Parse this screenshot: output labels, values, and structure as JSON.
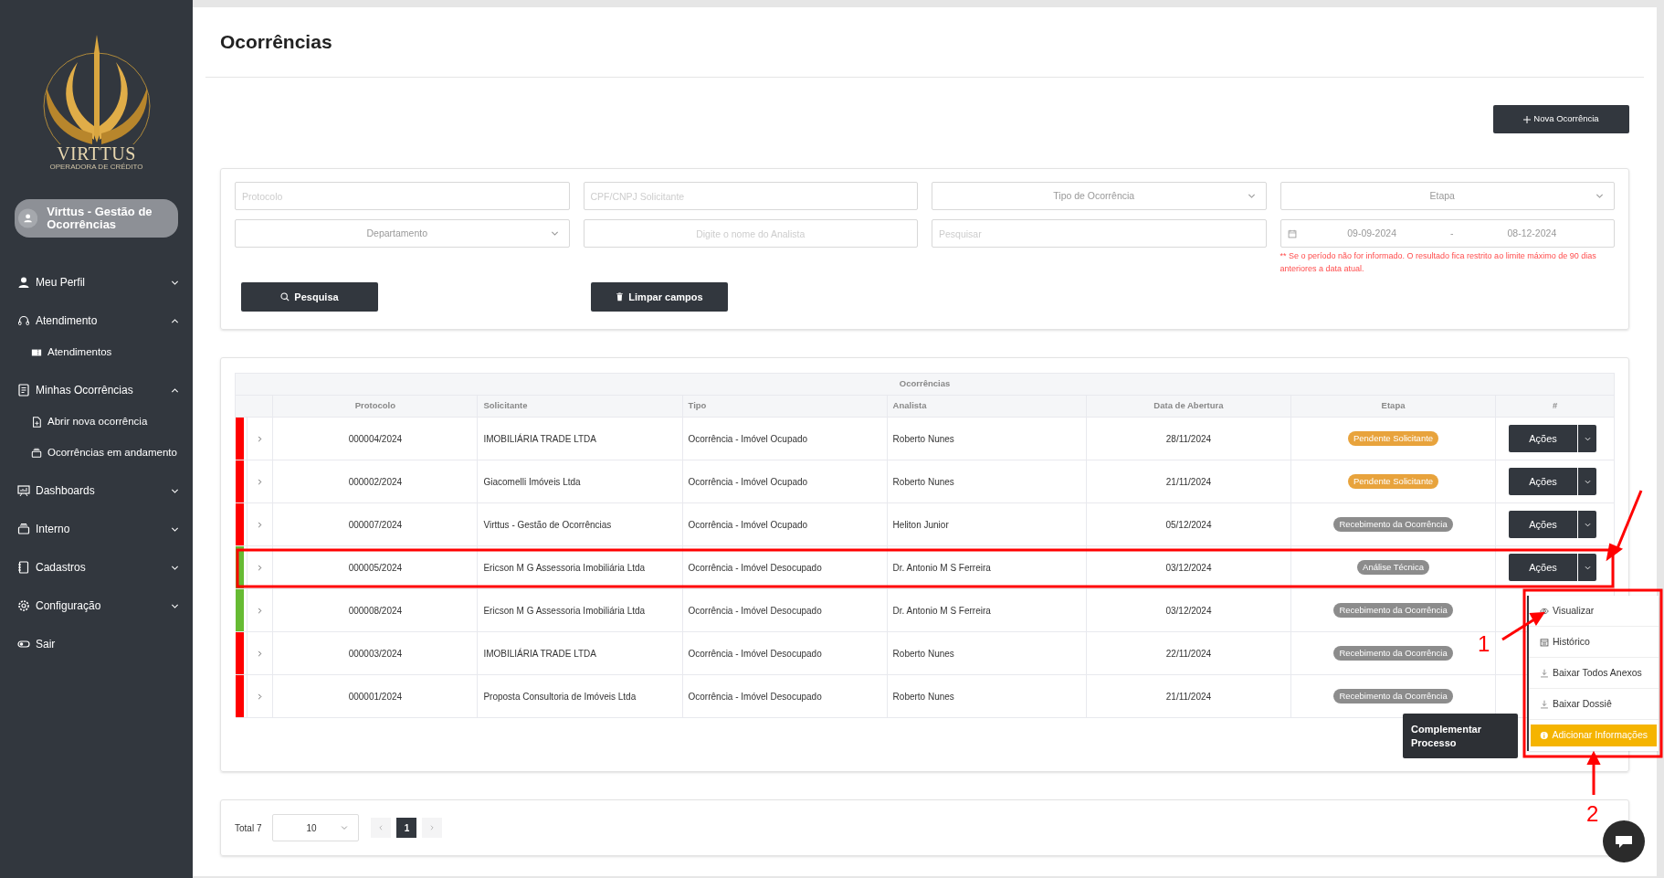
{
  "sidebar": {
    "logo": {
      "name": "VIRTTUS",
      "tagline": "OPERADORA DE CRÉDITO"
    },
    "user": "Virttus - Gestão de Ocorrências",
    "items": [
      {
        "label": "Meu Perfil",
        "expanded": false
      },
      {
        "label": "Atendimento",
        "expanded": true,
        "children": [
          {
            "label": "Atendimentos"
          }
        ]
      },
      {
        "label": "Minhas Ocorrências",
        "expanded": true,
        "children": [
          {
            "label": "Abrir nova ocorrência"
          },
          {
            "label": "Ocorrências em andamento"
          }
        ]
      },
      {
        "label": "Dashboards",
        "expanded": false
      },
      {
        "label": "Interno",
        "expanded": false
      },
      {
        "label": "Cadastros",
        "expanded": false
      },
      {
        "label": "Configuração",
        "expanded": false
      },
      {
        "label": "Sair"
      }
    ]
  },
  "page": {
    "title": "Ocorrências",
    "new_button": "Nova Ocorrência"
  },
  "filters": {
    "fields": [
      {
        "kind": "text",
        "placeholder": "Protocolo"
      },
      {
        "kind": "text",
        "placeholder": "CPF/CNPJ Solicitante"
      },
      {
        "kind": "select",
        "placeholder": "Tipo de Ocorrência"
      },
      {
        "kind": "select",
        "placeholder": "Etapa"
      },
      {
        "kind": "select",
        "placeholder": "Departamento"
      },
      {
        "kind": "center",
        "placeholder": "Digite o nome do Analista"
      },
      {
        "kind": "text",
        "placeholder": "Pesquisar"
      },
      {
        "kind": "daterange",
        "start": "09-09-2024",
        "separator": "-",
        "end": "08-12-2024",
        "note": "** Se o período não for informado. O resultado fica restrito ao limite máximo de 90 dias anteriores a data atual."
      }
    ],
    "search_button": "Pesquisa",
    "clear_button": "Limpar campos"
  },
  "table": {
    "group_title": "Ocorrências",
    "columns": [
      "Protocolo",
      "Solicitante",
      "Tipo",
      "Analista",
      "Data de Abertura",
      "Etapa",
      "#"
    ],
    "rows": [
      {
        "color": "#ff0000",
        "protocolo": "000004/2024",
        "solicitante": "IMOBILIÁRIA TRADE LTDA",
        "tipo": "Ocorrência - Imóvel Ocupado",
        "analista": "Roberto Nunes",
        "data": "28/11/2024",
        "etapa": {
          "label": "Pendente Solicitante",
          "color": "#e8a33c"
        },
        "action": "Ações"
      },
      {
        "color": "#ff0000",
        "protocolo": "000002/2024",
        "solicitante": "Giacomelli Imóveis Ltda",
        "tipo": "Ocorrência - Imóvel Ocupado",
        "analista": "Roberto Nunes",
        "data": "21/11/2024",
        "etapa": {
          "label": "Pendente Solicitante",
          "color": "#e8a33c"
        },
        "action": "Ações"
      },
      {
        "color": "#ff0000",
        "protocolo": "000007/2024",
        "solicitante": "Virttus - Gestão de Ocorrências",
        "tipo": "Ocorrência - Imóvel Ocupado",
        "analista": "Heliton Junior",
        "data": "05/12/2024",
        "etapa": {
          "label": "Recebimento da Ocorrência",
          "color": "#8c8c8c"
        },
        "action": "Ações"
      },
      {
        "color": "#66bb33",
        "protocolo": "000005/2024",
        "solicitante": "Ericson M G Assessoria Imobiliária Ltda",
        "tipo": "Ocorrência - Imóvel Desocupado",
        "analista": "Dr. Antonio M S Ferreira",
        "data": "03/12/2024",
        "etapa": {
          "label": "Análise Técnica",
          "color": "#8c8c8c"
        },
        "action": "Ações"
      },
      {
        "color": "#66bb33",
        "protocolo": "000008/2024",
        "solicitante": "Ericson M G Assessoria Imobiliária Ltda",
        "tipo": "Ocorrência - Imóvel Desocupado",
        "analista": "Dr. Antonio M S Ferreira",
        "data": "03/12/2024",
        "etapa": {
          "label": "Recebimento da Ocorrência",
          "color": "#8c8c8c"
        }
      },
      {
        "color": "#ff0000",
        "protocolo": "000003/2024",
        "solicitante": "IMOBILIÁRIA TRADE LTDA",
        "tipo": "Ocorrência - Imóvel Desocupado",
        "analista": "Roberto Nunes",
        "data": "22/11/2024",
        "etapa": {
          "label": "Recebimento da Ocorrência",
          "color": "#8c8c8c"
        }
      },
      {
        "color": "#ff0000",
        "protocolo": "000001/2024",
        "solicitante": "Proposta Consultoria de Imóveis Ltda",
        "tipo": "Ocorrência - Imóvel Desocupado",
        "analista": "Roberto Nunes",
        "data": "21/11/2024",
        "etapa": {
          "label": "Recebimento da Ocorrência",
          "color": "#8c8c8c"
        }
      }
    ]
  },
  "actions_menu": {
    "items": [
      {
        "label": "Visualizar",
        "kind": "plain"
      },
      {
        "label": "Histórico",
        "kind": "plain"
      },
      {
        "label": "Baixar Todos Anexos",
        "kind": "plain"
      },
      {
        "label": "Baixar Dossiê",
        "kind": "plain"
      },
      {
        "label": "Adicionar Informações",
        "kind": "highlight"
      }
    ],
    "tooltip": "Complementar Processo"
  },
  "pagination": {
    "total": "Total 7",
    "page_size": "10",
    "pages": [
      {
        "label": "1",
        "selected": true
      }
    ]
  },
  "annotations": [
    {
      "label": "1"
    },
    {
      "label": "2"
    }
  ]
}
